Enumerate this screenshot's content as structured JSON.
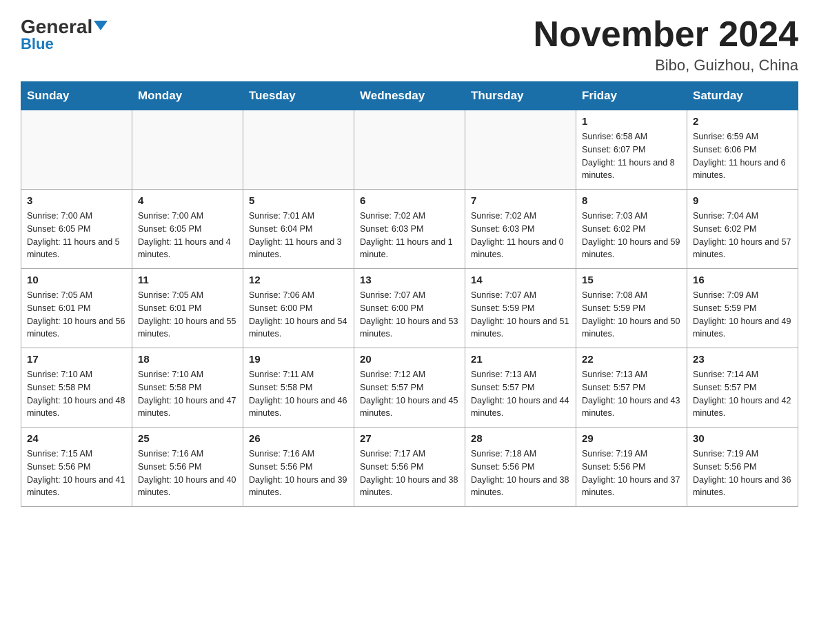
{
  "header": {
    "logo_main": "General",
    "logo_sub": "Blue",
    "title": "November 2024",
    "subtitle": "Bibo, Guizhou, China"
  },
  "days_of_week": [
    "Sunday",
    "Monday",
    "Tuesday",
    "Wednesday",
    "Thursday",
    "Friday",
    "Saturday"
  ],
  "weeks": [
    [
      {
        "day": "",
        "info": ""
      },
      {
        "day": "",
        "info": ""
      },
      {
        "day": "",
        "info": ""
      },
      {
        "day": "",
        "info": ""
      },
      {
        "day": "",
        "info": ""
      },
      {
        "day": "1",
        "info": "Sunrise: 6:58 AM\nSunset: 6:07 PM\nDaylight: 11 hours and 8 minutes."
      },
      {
        "day": "2",
        "info": "Sunrise: 6:59 AM\nSunset: 6:06 PM\nDaylight: 11 hours and 6 minutes."
      }
    ],
    [
      {
        "day": "3",
        "info": "Sunrise: 7:00 AM\nSunset: 6:05 PM\nDaylight: 11 hours and 5 minutes."
      },
      {
        "day": "4",
        "info": "Sunrise: 7:00 AM\nSunset: 6:05 PM\nDaylight: 11 hours and 4 minutes."
      },
      {
        "day": "5",
        "info": "Sunrise: 7:01 AM\nSunset: 6:04 PM\nDaylight: 11 hours and 3 minutes."
      },
      {
        "day": "6",
        "info": "Sunrise: 7:02 AM\nSunset: 6:03 PM\nDaylight: 11 hours and 1 minute."
      },
      {
        "day": "7",
        "info": "Sunrise: 7:02 AM\nSunset: 6:03 PM\nDaylight: 11 hours and 0 minutes."
      },
      {
        "day": "8",
        "info": "Sunrise: 7:03 AM\nSunset: 6:02 PM\nDaylight: 10 hours and 59 minutes."
      },
      {
        "day": "9",
        "info": "Sunrise: 7:04 AM\nSunset: 6:02 PM\nDaylight: 10 hours and 57 minutes."
      }
    ],
    [
      {
        "day": "10",
        "info": "Sunrise: 7:05 AM\nSunset: 6:01 PM\nDaylight: 10 hours and 56 minutes."
      },
      {
        "day": "11",
        "info": "Sunrise: 7:05 AM\nSunset: 6:01 PM\nDaylight: 10 hours and 55 minutes."
      },
      {
        "day": "12",
        "info": "Sunrise: 7:06 AM\nSunset: 6:00 PM\nDaylight: 10 hours and 54 minutes."
      },
      {
        "day": "13",
        "info": "Sunrise: 7:07 AM\nSunset: 6:00 PM\nDaylight: 10 hours and 53 minutes."
      },
      {
        "day": "14",
        "info": "Sunrise: 7:07 AM\nSunset: 5:59 PM\nDaylight: 10 hours and 51 minutes."
      },
      {
        "day": "15",
        "info": "Sunrise: 7:08 AM\nSunset: 5:59 PM\nDaylight: 10 hours and 50 minutes."
      },
      {
        "day": "16",
        "info": "Sunrise: 7:09 AM\nSunset: 5:59 PM\nDaylight: 10 hours and 49 minutes."
      }
    ],
    [
      {
        "day": "17",
        "info": "Sunrise: 7:10 AM\nSunset: 5:58 PM\nDaylight: 10 hours and 48 minutes."
      },
      {
        "day": "18",
        "info": "Sunrise: 7:10 AM\nSunset: 5:58 PM\nDaylight: 10 hours and 47 minutes."
      },
      {
        "day": "19",
        "info": "Sunrise: 7:11 AM\nSunset: 5:58 PM\nDaylight: 10 hours and 46 minutes."
      },
      {
        "day": "20",
        "info": "Sunrise: 7:12 AM\nSunset: 5:57 PM\nDaylight: 10 hours and 45 minutes."
      },
      {
        "day": "21",
        "info": "Sunrise: 7:13 AM\nSunset: 5:57 PM\nDaylight: 10 hours and 44 minutes."
      },
      {
        "day": "22",
        "info": "Sunrise: 7:13 AM\nSunset: 5:57 PM\nDaylight: 10 hours and 43 minutes."
      },
      {
        "day": "23",
        "info": "Sunrise: 7:14 AM\nSunset: 5:57 PM\nDaylight: 10 hours and 42 minutes."
      }
    ],
    [
      {
        "day": "24",
        "info": "Sunrise: 7:15 AM\nSunset: 5:56 PM\nDaylight: 10 hours and 41 minutes."
      },
      {
        "day": "25",
        "info": "Sunrise: 7:16 AM\nSunset: 5:56 PM\nDaylight: 10 hours and 40 minutes."
      },
      {
        "day": "26",
        "info": "Sunrise: 7:16 AM\nSunset: 5:56 PM\nDaylight: 10 hours and 39 minutes."
      },
      {
        "day": "27",
        "info": "Sunrise: 7:17 AM\nSunset: 5:56 PM\nDaylight: 10 hours and 38 minutes."
      },
      {
        "day": "28",
        "info": "Sunrise: 7:18 AM\nSunset: 5:56 PM\nDaylight: 10 hours and 38 minutes."
      },
      {
        "day": "29",
        "info": "Sunrise: 7:19 AM\nSunset: 5:56 PM\nDaylight: 10 hours and 37 minutes."
      },
      {
        "day": "30",
        "info": "Sunrise: 7:19 AM\nSunset: 5:56 PM\nDaylight: 10 hours and 36 minutes."
      }
    ]
  ]
}
